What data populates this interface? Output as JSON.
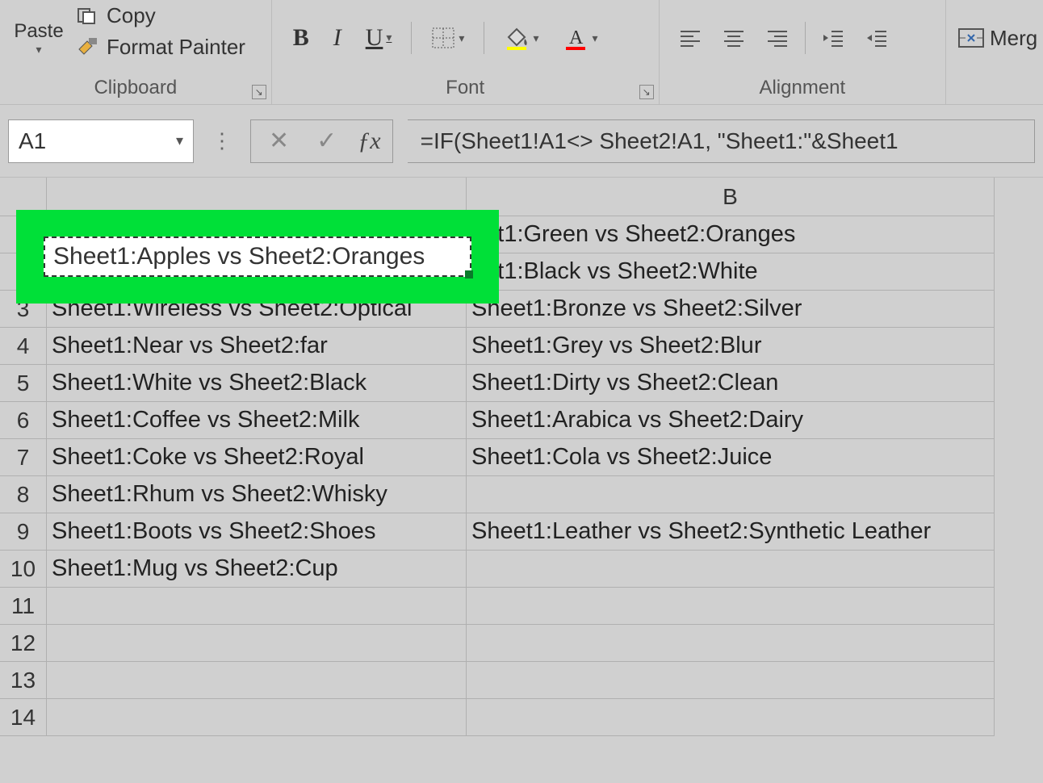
{
  "ribbon": {
    "clipboard": {
      "paste_label": "Paste",
      "copy_label": "Copy",
      "format_painter_label": "Format Painter",
      "group_label": "Clipboard"
    },
    "font": {
      "bold": "B",
      "italic": "I",
      "underline": "U",
      "group_label": "Font"
    },
    "alignment": {
      "group_label": "Alignment",
      "merge_label": "Merg"
    }
  },
  "formula_bar": {
    "name_box_value": "A1",
    "formula_text": "=IF(Sheet1!A1<> Sheet2!A1, \"Sheet1:\"&Sheet1"
  },
  "columns": [
    "",
    "B"
  ],
  "rows": [
    {
      "n": "",
      "a": "Sheet1:Apples vs Sheet2:Oranges",
      "b": "eet1:Green vs Sheet2:Oranges"
    },
    {
      "n": "",
      "a": "",
      "b": "eet1:Black vs Sheet2:White"
    },
    {
      "n": "3",
      "a": "Sheet1:Wireless vs Sheet2:Optical",
      "b": "Sheet1:Bronze vs Sheet2:Silver"
    },
    {
      "n": "4",
      "a": "Sheet1:Near vs Sheet2:far",
      "b": "Sheet1:Grey vs Sheet2:Blur"
    },
    {
      "n": "5",
      "a": "Sheet1:White vs Sheet2:Black",
      "b": "Sheet1:Dirty vs Sheet2:Clean"
    },
    {
      "n": "6",
      "a": "Sheet1:Coffee vs Sheet2:Milk",
      "b": "Sheet1:Arabica vs Sheet2:Dairy"
    },
    {
      "n": "7",
      "a": "Sheet1:Coke vs Sheet2:Royal",
      "b": "Sheet1:Cola vs Sheet2:Juice"
    },
    {
      "n": "8",
      "a": "Sheet1:Rhum vs Sheet2:Whisky",
      "b": ""
    },
    {
      "n": "9",
      "a": "Sheet1:Boots vs Sheet2:Shoes",
      "b": "Sheet1:Leather vs Sheet2:Synthetic Leather"
    },
    {
      "n": "10",
      "a": "Sheet1:Mug vs Sheet2:Cup",
      "b": ""
    },
    {
      "n": "11",
      "a": "",
      "b": ""
    },
    {
      "n": "12",
      "a": "",
      "b": ""
    },
    {
      "n": "13",
      "a": "",
      "b": ""
    },
    {
      "n": "14",
      "a": "",
      "b": ""
    }
  ],
  "highlighted_cell_value": "Sheet1:Apples vs Sheet2:Oranges"
}
